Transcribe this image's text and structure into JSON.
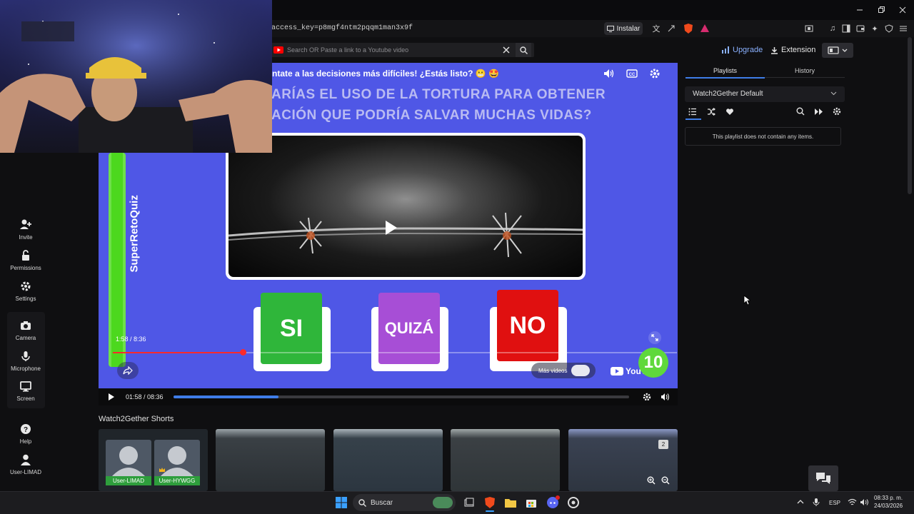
{
  "browser": {
    "url": "access_key=p8mgf4ntm2pqqm1man3x9f",
    "install_label": "Instalar"
  },
  "search": {
    "placeholder": "Search OR Paste a link to a Youtube video"
  },
  "sidebar": {
    "items": [
      {
        "label": "Invite",
        "icon": "add-user-icon"
      },
      {
        "label": "Permissions",
        "icon": "lock-icon"
      },
      {
        "label": "Settings",
        "icon": "gear-icon"
      },
      {
        "label": "Camera",
        "icon": "camera-icon"
      },
      {
        "label": "Microphone",
        "icon": "microphone-icon"
      },
      {
        "label": "Screen",
        "icon": "monitor-icon"
      },
      {
        "label": "Help",
        "icon": "help-icon"
      },
      {
        "label": "User-LIMAD",
        "icon": "user-icon"
      }
    ]
  },
  "video": {
    "title": "ntate a las decisiones más difíciles! ¿Estás listo? 😬 🤩",
    "question_line1": "ARÍAS EL USO DE LA TORTURA PARA OBTENER",
    "question_line2": "ACIÓN QUE PODRÍA SALVAR MUCHAS VIDAS?",
    "channel_brand": "SuperRetoQuiz",
    "answers": [
      {
        "label": "SI",
        "color": "#2fb63a"
      },
      {
        "label": "QUIZÁ",
        "color": "#a74ed6"
      },
      {
        "label": "NO",
        "color": "#e01010"
      }
    ],
    "embedded_time": "1:58 / 8:36",
    "more_videos": "Más videos",
    "countdown": "10",
    "youtube": "YouTube",
    "progress_fraction": 0.23
  },
  "controls": {
    "time": "01:58 / 08:36",
    "progress_fraction": 0.23
  },
  "shorts": {
    "title": "Watch2Gether Shorts",
    "users": [
      "User-LIMAD",
      "User-HYWGG"
    ],
    "badge_count": "2"
  },
  "right_panel": {
    "upgrade_label": "Upgrade",
    "extension_label": "Extension",
    "tabs": [
      "Playlists",
      "History"
    ],
    "playlist_name": "Watch2Gether Default",
    "empty_message": "This playlist does not contain any items."
  },
  "taskbar": {
    "search_label": "Buscar",
    "language": "ESP",
    "time": "08:33 p. m.",
    "date": "24/03/2026"
  },
  "colors": {
    "accent": "#3f7de8",
    "video_bg": "#4f57e6",
    "green": "#4cd81e",
    "upgrade": "#8ab1ff"
  }
}
